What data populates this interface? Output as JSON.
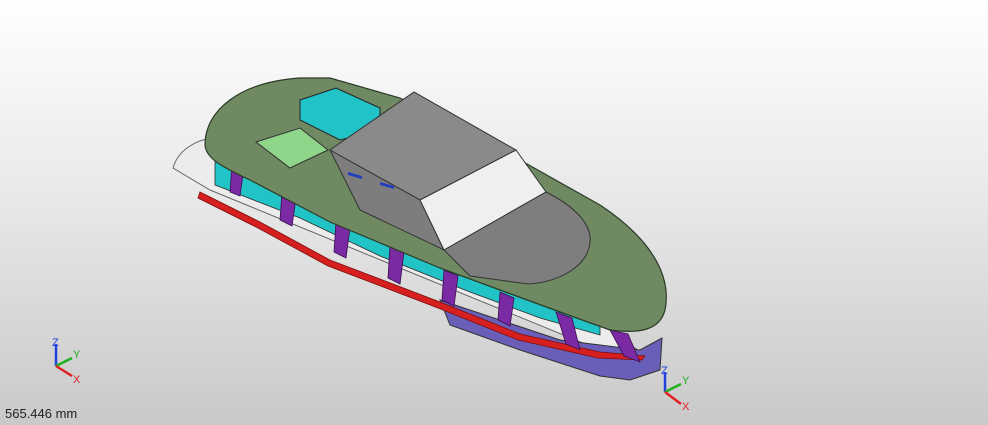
{
  "viewport": {
    "scale_readout": "565.446 mm"
  },
  "axis_triad": {
    "x_label": "X",
    "y_label": "Y",
    "z_label": "Z"
  },
  "colors": {
    "deck_green": "#6f8a63",
    "hull_gray": "#e6e6e6",
    "cabin_gray": "#8a8a8a",
    "window_white": "#efefef",
    "glazing_cyan": "#22c3c6",
    "frame_purple": "#7a2aa3",
    "keel_red": "#d6201f",
    "hull_purple": "#6a5fb8",
    "hatch_green": "#8fd68a",
    "axis_x": "#e02020",
    "axis_y": "#20b020",
    "axis_z": "#2040e0"
  }
}
